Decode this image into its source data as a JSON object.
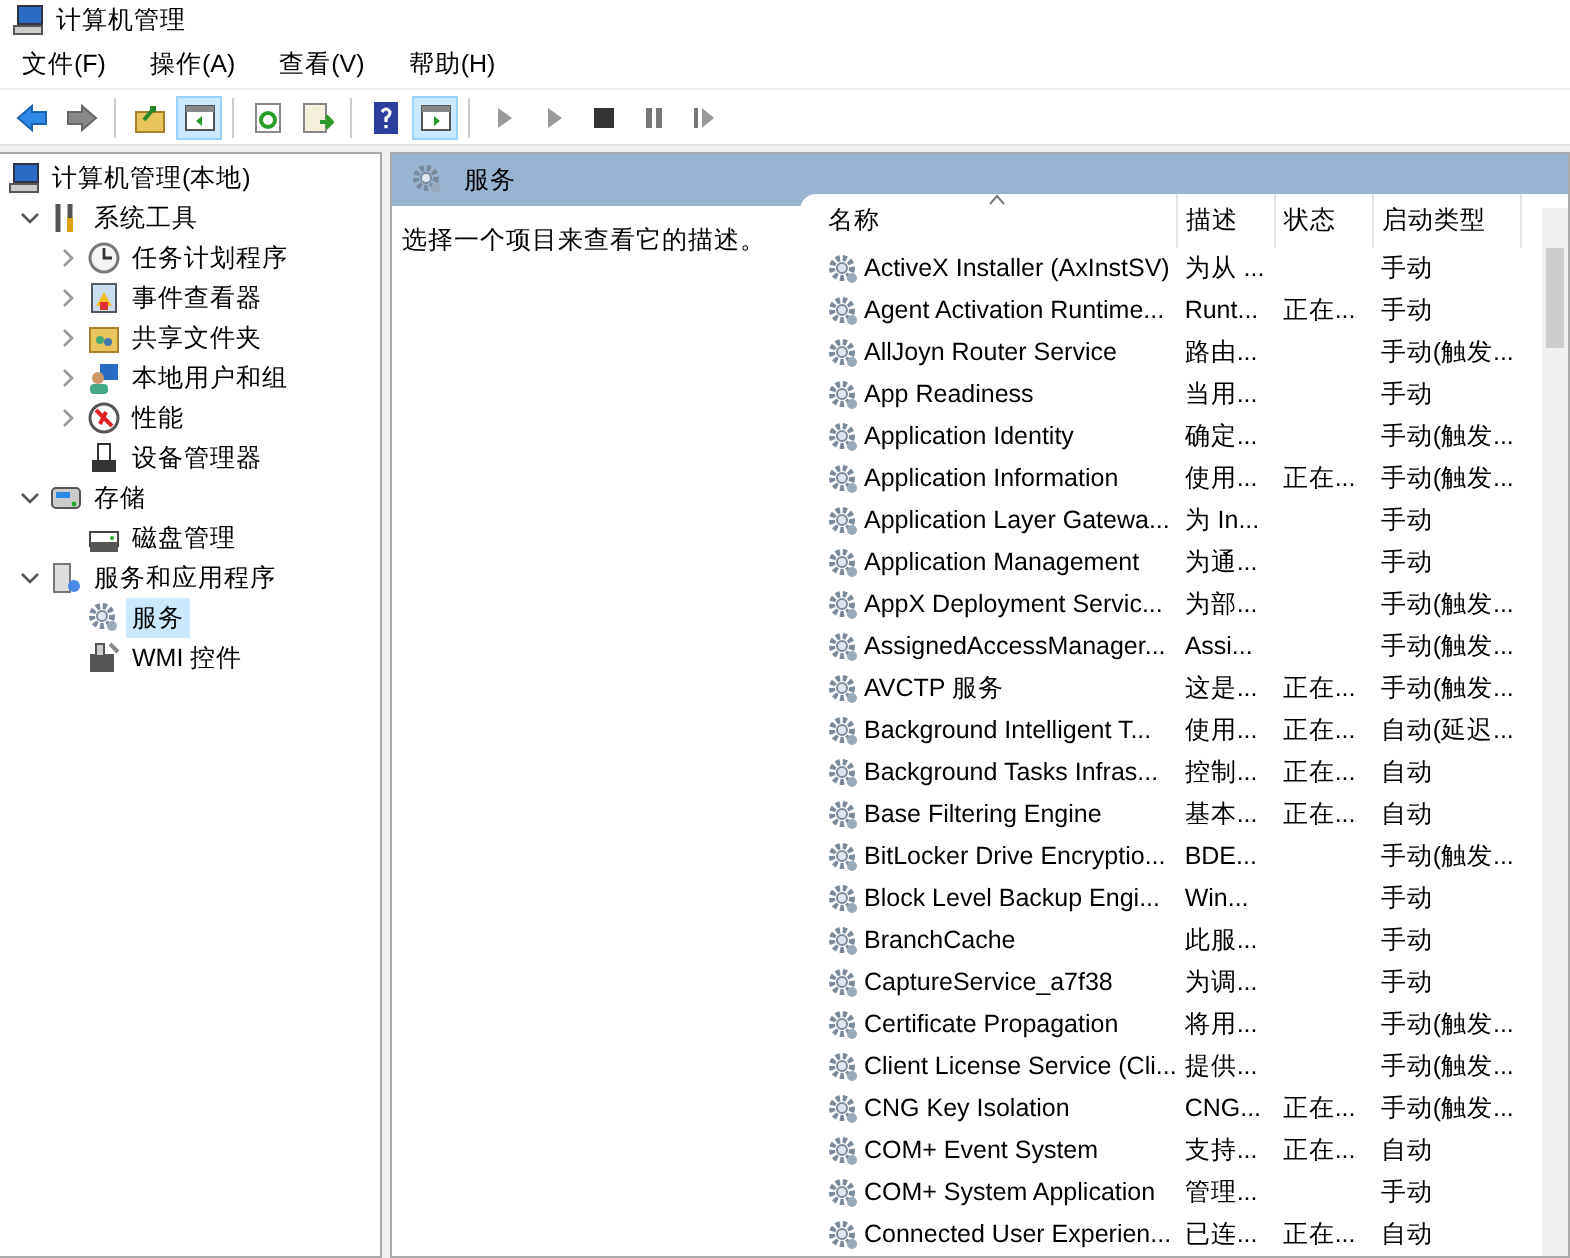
{
  "window": {
    "title": "计算机管理"
  },
  "menu": [
    "文件(F)",
    "操作(A)",
    "查看(V)",
    "帮助(H)"
  ],
  "toolbar": [
    {
      "pressed": false
    },
    {
      "pressed": false
    },
    {
      "pressed": false
    },
    {
      "pressed": true
    },
    {
      "pressed": false
    },
    {
      "pressed": false
    },
    {
      "pressed": false
    },
    {
      "pressed": true
    },
    {
      "pressed": false
    },
    {
      "pressed": false
    },
    {
      "pressed": false
    },
    {
      "pressed": false
    },
    {
      "pressed": false
    }
  ],
  "tree": [
    {
      "label": "计算机管理(本地)",
      "selected": false,
      "children": [
        {
          "label": "系统工具",
          "expanded": true,
          "selected": false,
          "children": [
            {
              "label": "任务计划程序",
              "expanded": false,
              "selected": false
            },
            {
              "label": "事件查看器",
              "expanded": false,
              "selected": false
            },
            {
              "label": "共享文件夹",
              "expanded": false,
              "selected": false
            },
            {
              "label": "本地用户和组",
              "expanded": false,
              "selected": false
            },
            {
              "label": "性能",
              "expanded": false,
              "selected": false
            },
            {
              "label": "设备管理器",
              "selected": false
            }
          ]
        },
        {
          "label": "存储",
          "expanded": true,
          "selected": false,
          "children": [
            {
              "label": "磁盘管理",
              "selected": false
            }
          ]
        },
        {
          "label": "服务和应用程序",
          "expanded": true,
          "selected": false,
          "children": [
            {
              "label": "服务",
              "selected": true
            },
            {
              "label": "WMI 控件",
              "selected": false
            }
          ]
        }
      ]
    }
  ],
  "panel": {
    "title": "服务",
    "description": "选择一个项目来查看它的描述。"
  },
  "table": {
    "columns": [
      "名称",
      "描述",
      "状态",
      "启动类型"
    ],
    "rows": [
      [
        "ActiveX Installer (AxInstSV)",
        "为从 ...",
        "",
        "手动"
      ],
      [
        "Agent Activation Runtime...",
        "Runt...",
        "正在...",
        "手动"
      ],
      [
        "AllJoyn Router Service",
        "路由...",
        "",
        "手动(触发..."
      ],
      [
        "App Readiness",
        "当用...",
        "",
        "手动"
      ],
      [
        "Application Identity",
        "确定...",
        "",
        "手动(触发..."
      ],
      [
        "Application Information",
        "使用...",
        "正在...",
        "手动(触发..."
      ],
      [
        "Application Layer Gatewa...",
        "为 In...",
        "",
        "手动"
      ],
      [
        "Application Management",
        "为通...",
        "",
        "手动"
      ],
      [
        "AppX Deployment Servic...",
        "为部...",
        "",
        "手动(触发..."
      ],
      [
        "AssignedAccessManager...",
        "Assi...",
        "",
        "手动(触发..."
      ],
      [
        "AVCTP 服务",
        "这是...",
        "正在...",
        "手动(触发..."
      ],
      [
        "Background Intelligent T...",
        "使用...",
        "正在...",
        "自动(延迟..."
      ],
      [
        "Background Tasks Infras...",
        "控制...",
        "正在...",
        "自动"
      ],
      [
        "Base Filtering Engine",
        "基本...",
        "正在...",
        "自动"
      ],
      [
        "BitLocker Drive Encryptio...",
        "BDE...",
        "",
        "手动(触发..."
      ],
      [
        "Block Level Backup Engi...",
        "Win...",
        "",
        "手动"
      ],
      [
        "BranchCache",
        "此服...",
        "",
        "手动"
      ],
      [
        "CaptureService_a7f38",
        "为调...",
        "",
        "手动"
      ],
      [
        "Certificate Propagation",
        "将用...",
        "",
        "手动(触发..."
      ],
      [
        "Client License Service (Cli...",
        "提供...",
        "",
        "手动(触发..."
      ],
      [
        "CNG Key Isolation",
        "CNG...",
        "正在...",
        "手动(触发..."
      ],
      [
        "COM+ Event System",
        "支持...",
        "正在...",
        "自动"
      ],
      [
        "COM+ System Application",
        "管理...",
        "",
        "手动"
      ],
      [
        "Connected User Experien...",
        "已连...",
        "正在...",
        "自动"
      ]
    ]
  }
}
